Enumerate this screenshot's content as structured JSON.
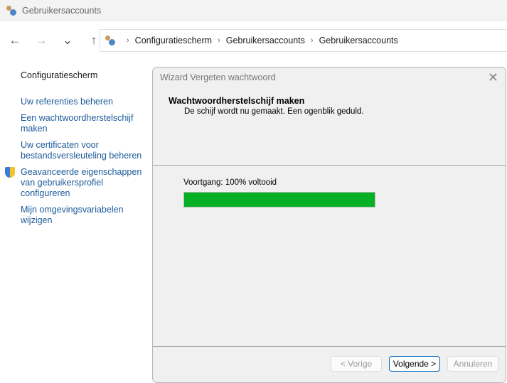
{
  "window": {
    "title": "Gebruikersaccounts"
  },
  "nav": {
    "back": "←",
    "forward": "→",
    "recent": "⌄",
    "up": "↑"
  },
  "breadcrumb": [
    "Configuratiescherm",
    "Gebruikersaccounts",
    "Gebruikersaccounts"
  ],
  "sidebar": {
    "heading": "Configuratiescherm",
    "items": [
      {
        "label": "Uw referenties beheren"
      },
      {
        "label": "Een wachtwoordherstelschijf maken"
      },
      {
        "label": "Uw certificaten voor bestandsversleuteling beheren"
      },
      {
        "label": "Geavanceerde eigenschappen van gebruikersprofiel configureren"
      },
      {
        "label": "Mijn omgevingsvariabelen wijzigen"
      }
    ]
  },
  "dialog": {
    "title": "Wizard Vergeten wachtwoord",
    "close": "✕",
    "heading": "Wachtwoordherstelschijf maken",
    "subtitle": "De schijf wordt nu gemaakt. Een ogenblik geduld.",
    "progress_label": "Voortgang: 100% voltooid",
    "progress": 100,
    "progress_color": "#06b025",
    "buttons": {
      "back": "< Vorige",
      "next": "Volgende >",
      "cancel": "Annuleren"
    }
  }
}
